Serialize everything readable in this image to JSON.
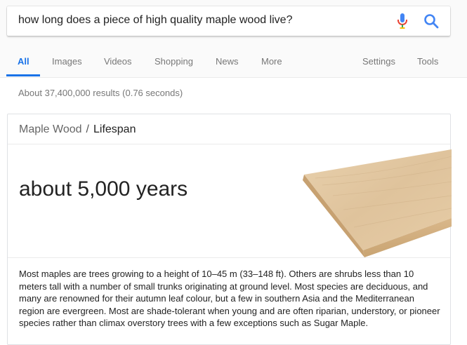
{
  "search": {
    "query": "how long does a piece of high quality maple wood live?",
    "mic_icon": "mic-icon",
    "search_icon": "search-icon"
  },
  "tabs": [
    {
      "label": "All",
      "active": true
    },
    {
      "label": "Images"
    },
    {
      "label": "Videos"
    },
    {
      "label": "Shopping"
    },
    {
      "label": "News"
    },
    {
      "label": "More"
    }
  ],
  "tools": [
    {
      "label": "Settings"
    },
    {
      "label": "Tools"
    }
  ],
  "results": {
    "stats": "About 37,400,000 results (0.76 seconds)"
  },
  "card": {
    "breadcrumb_parent": "Maple Wood",
    "breadcrumb_sep": "/",
    "breadcrumb_child": "Lifespan",
    "answer": "about 5,000 years",
    "description": "Most maples are trees growing to a height of 10–45 m (33–148 ft). Others are shrubs less than 10 meters tall with a number of small trunks originating at ground level. Most species are deciduous, and many are renowned for their autumn leaf colour, but a few in southern Asia and the Mediterranean region are evergreen. Most are shade-tolerant when young and are often riparian, understory, or pioneer species rather than climax overstory trees with a few exceptions such as Sugar Maple."
  },
  "colors": {
    "accent": "#1a73e8",
    "muted_text": "#777777"
  }
}
